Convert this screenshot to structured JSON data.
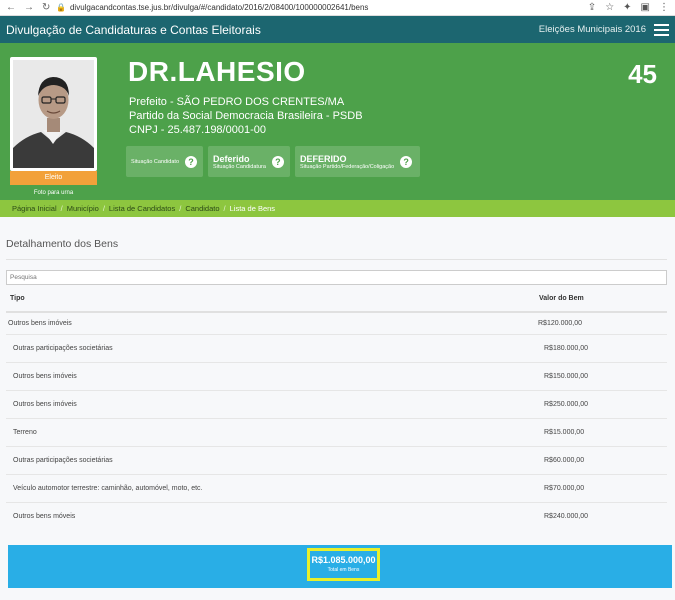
{
  "browser": {
    "url": "divulgacandcontas.tse.jus.br/divulga/#/candidato/2016/2/08400/100000002641/bens"
  },
  "topbar": {
    "site_title": "Divulgação de Candidaturas e Contas Eleitorais",
    "election": "Eleições Municipais 2016"
  },
  "candidate": {
    "name": "DR.LAHESIO",
    "number": "45",
    "office_line": "Prefeito - SÃO PEDRO DOS CRENTES/MA",
    "party_line": "Partido da Social Democracia Brasileira - PSDB",
    "cnpj_line": "CNPJ - 25.487.198/0001-00",
    "photo_badge": "Eleito",
    "photo_caption": "Foto para urna"
  },
  "status": [
    {
      "value": "",
      "label": "Situação Candidato"
    },
    {
      "value": "Deferido",
      "label": "Situação Candidatura"
    },
    {
      "value": "DEFERIDO",
      "label": "Situação Partido/Federação/Coligação"
    }
  ],
  "breadcrumb": [
    "Página Inicial",
    "Município",
    "Lista de Candidatos",
    "Candidato",
    "Lista de Bens"
  ],
  "section": {
    "title": "Detalhamento dos Bens",
    "search_placeholder": "Pesquisa"
  },
  "table": {
    "headers": {
      "tipo": "Tipo",
      "valor": "Valor do Bem"
    },
    "rows": [
      {
        "tipo": "Outros bens imóveis",
        "valor": "R$120.000,00"
      },
      {
        "tipo": "Outras participações societárias",
        "valor": "R$180.000,00"
      },
      {
        "tipo": "Outros bens imóveis",
        "valor": "R$150.000,00"
      },
      {
        "tipo": "Outros bens imóveis",
        "valor": "R$250.000,00"
      },
      {
        "tipo": "Terreno",
        "valor": "R$15.000,00"
      },
      {
        "tipo": "Outras participações societárias",
        "valor": "R$60.000,00"
      },
      {
        "tipo": "Veículo automotor terrestre: caminhão, automóvel, moto, etc.",
        "valor": "R$70.000,00"
      },
      {
        "tipo": "Outros bens móveis",
        "valor": "R$240.000,00"
      }
    ]
  },
  "total": {
    "amount": "R$1.085.000,00",
    "label": "Total em Bens"
  },
  "colors": {
    "topbar": "#1c6670",
    "header_green": "#4da14a",
    "breadcrumb_green": "#8dc63f",
    "total_blue": "#29aee6",
    "highlight_yellow": "#e8ef2c"
  }
}
